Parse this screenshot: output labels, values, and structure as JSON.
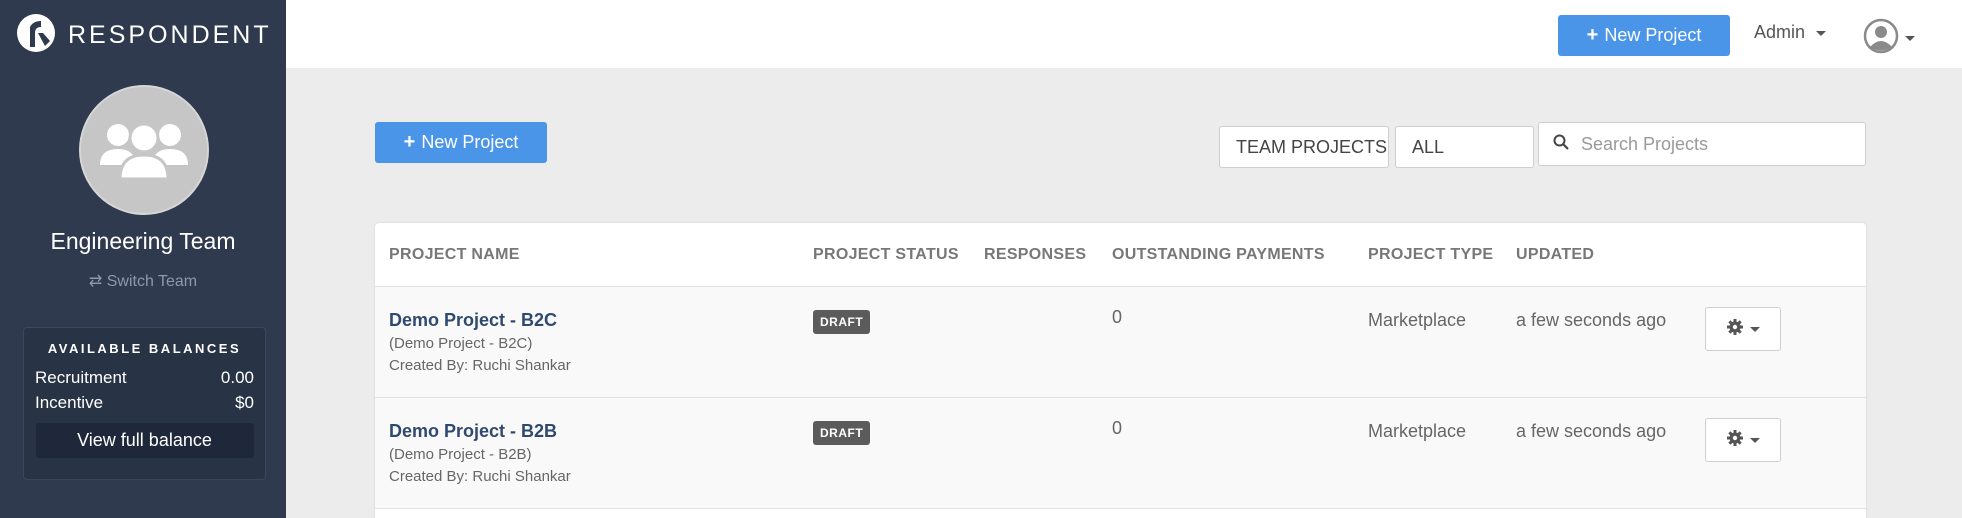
{
  "sidebar": {
    "brand": "RESPONDENT",
    "team_name": "Engineering Team",
    "switch_team": "Switch Team",
    "balances": {
      "title": "AVAILABLE BALANCES",
      "rows": [
        {
          "label": "Recruitment",
          "value": "0.00"
        },
        {
          "label": "Incentive",
          "value": "$0"
        }
      ],
      "view_full": "View full balance"
    }
  },
  "topbar": {
    "new_project": "New Project",
    "admin": "Admin"
  },
  "main": {
    "new_project": "New Project",
    "filters": {
      "scope": "TEAM PROJECTS",
      "status": "ALL"
    },
    "search": {
      "placeholder": "Search Projects"
    },
    "table": {
      "headers": [
        "PROJECT NAME",
        "PROJECT STATUS",
        "RESPONSES",
        "OUTSTANDING PAYMENTS",
        "PROJECT TYPE",
        "UPDATED"
      ],
      "rows": [
        {
          "name": "Demo Project - B2C",
          "subtitle": "(Demo Project - B2C)",
          "created_by": "Created By: Ruchi Shankar",
          "status": "DRAFT",
          "responses": "",
          "outstanding": "0",
          "type": "Marketplace",
          "updated": "a few seconds ago"
        },
        {
          "name": "Demo Project - B2B",
          "subtitle": "(Demo Project - B2B)",
          "created_by": "Created By: Ruchi Shankar",
          "status": "DRAFT",
          "responses": "",
          "outstanding": "0",
          "type": "Marketplace",
          "updated": "a few seconds ago"
        }
      ]
    }
  },
  "icons": {
    "brand_logo": "respondent-logo",
    "team_avatar": "group-icon",
    "switch": "exchange-icon",
    "plus": "plus-icon",
    "search": "search-icon",
    "user": "user-circle-icon",
    "gear": "gear-icon",
    "caret": "caret-down-icon"
  },
  "colors": {
    "sidebar_bg": "#2f3a4f",
    "primary": "#4a95e8",
    "badge": "#5b5b5b",
    "link": "#2f4a6e"
  }
}
